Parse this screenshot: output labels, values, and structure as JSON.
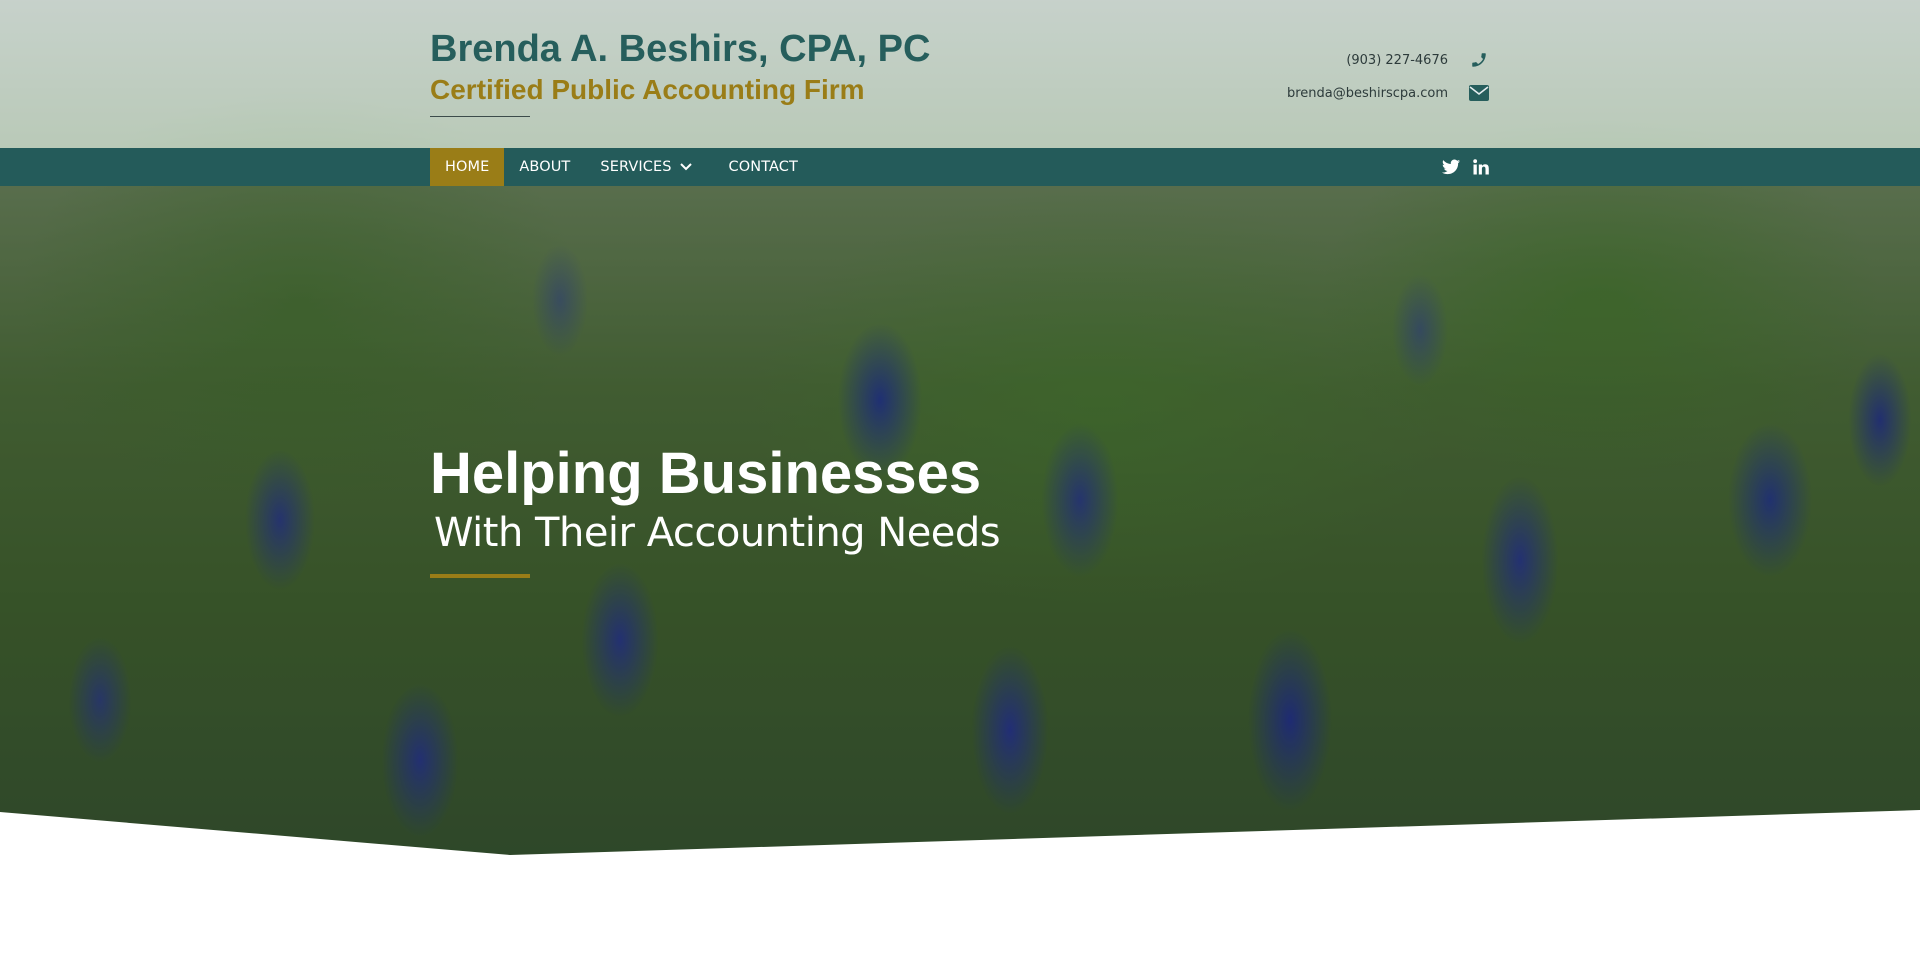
{
  "header": {
    "brand_name": "Brenda A. Beshirs, CPA, PC",
    "tagline": "Certified Public Accounting Firm",
    "phone": "(903) 227-4676",
    "email": "brenda@beshirscpa.com",
    "phone_icon": "phone-icon",
    "email_icon": "envelope-icon"
  },
  "nav": {
    "items": [
      {
        "label": "HOME",
        "active": true
      },
      {
        "label": "ABOUT",
        "active": false
      },
      {
        "label": "SERVICES",
        "active": false,
        "has_dropdown": true
      },
      {
        "label": "CONTACT",
        "active": false
      }
    ],
    "social": [
      {
        "name": "twitter-icon"
      },
      {
        "name": "linkedin-icon"
      }
    ]
  },
  "hero": {
    "title": "Helping Businesses",
    "subtitle": "With Their Accounting Needs"
  },
  "colors": {
    "primary_teal": "#245b5a",
    "brand_teal": "#265e5c",
    "accent_gold": "#9a7d17",
    "white": "#ffffff"
  }
}
